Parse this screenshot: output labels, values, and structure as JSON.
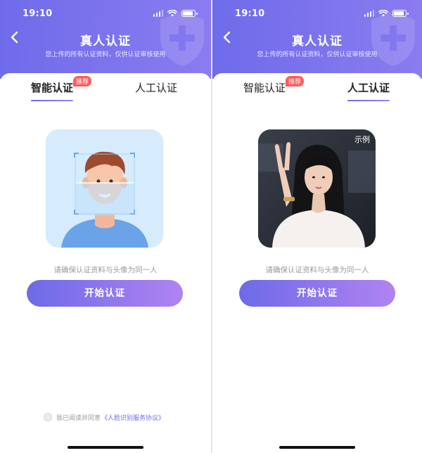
{
  "screens": [
    {
      "time": "19:10",
      "title": "真人认证",
      "subtitle": "您上传的所有认证资料，仅供认证审核使用",
      "tabs": [
        {
          "label": "智能认证",
          "active": true
        },
        {
          "label": "人工认证",
          "active": false
        }
      ],
      "recommend_tag": "推荐",
      "hint": "请确保认证资料与头像为同一人",
      "button": "开始认证",
      "agreement_prefix": "我已阅读并同意",
      "agreement_link": "《人脸识别服务协议》"
    },
    {
      "time": "19:10",
      "title": "真人认证",
      "subtitle": "您上传的所有认证资料，仅供认证审核使用",
      "tabs": [
        {
          "label": "智能认证",
          "active": false
        },
        {
          "label": "人工认证",
          "active": true
        }
      ],
      "recommend_tag": "推荐",
      "example_label": "示例",
      "hint": "请确保认证资料与头像为同一人",
      "button": "开始认证"
    }
  ],
  "colors": {
    "header_start": "#6f6bea",
    "header_end": "#8a7cf0",
    "button_start": "#6d6ae8",
    "button_end": "#b083f1",
    "tag": "#ff5d5d"
  },
  "battery_level": 0.85
}
